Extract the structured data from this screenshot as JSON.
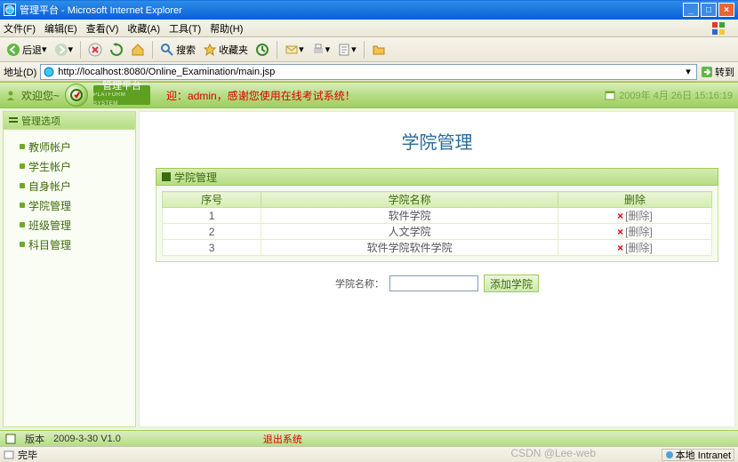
{
  "window": {
    "title": "管理平台 - Microsoft Internet Explorer"
  },
  "menus": [
    "文件(F)",
    "编辑(E)",
    "查看(V)",
    "收藏(A)",
    "工具(T)",
    "帮助(H)"
  ],
  "toolbar": {
    "back": "后退"
  },
  "addr": {
    "label": "地址(D)",
    "url": "http://localhost:8080/Online_Examination/main.jsp",
    "go": "转到"
  },
  "app": {
    "welcome": "欢迎您~",
    "brand": "管理平台",
    "brand_sub": "PLATFORM SYSTEM",
    "notice": "迎：admin，感谢您使用在线考试系统！",
    "datetime": "2009年 4月 26日 15:16:19"
  },
  "sidebar": {
    "head": "管理选项",
    "items": [
      "教师帐户",
      "学生帐户",
      "自身帐户",
      "学院管理",
      "班级管理",
      "科目管理"
    ]
  },
  "page": {
    "title": "学院管理",
    "panel_title": "学院管理",
    "cols": [
      "序号",
      "学院名称",
      "删除"
    ],
    "rows": [
      {
        "id": "1",
        "name": "软件学院"
      },
      {
        "id": "2",
        "name": "人文学院"
      },
      {
        "id": "3",
        "name": "软件学院软件学院"
      }
    ],
    "delete_label": "[删除]",
    "form_label": "学院名称：",
    "add_btn": "添加学院"
  },
  "footer": {
    "version_label": "版本",
    "version": "2009-3-30 V1.0",
    "logout": "退出系统"
  },
  "status": {
    "done": "完毕",
    "zone": "本地 Intranet"
  },
  "watermark": "CSDN @Lee-web",
  "toolbar_labels": {
    "search": "搜索",
    "fav": "收藏夹"
  }
}
